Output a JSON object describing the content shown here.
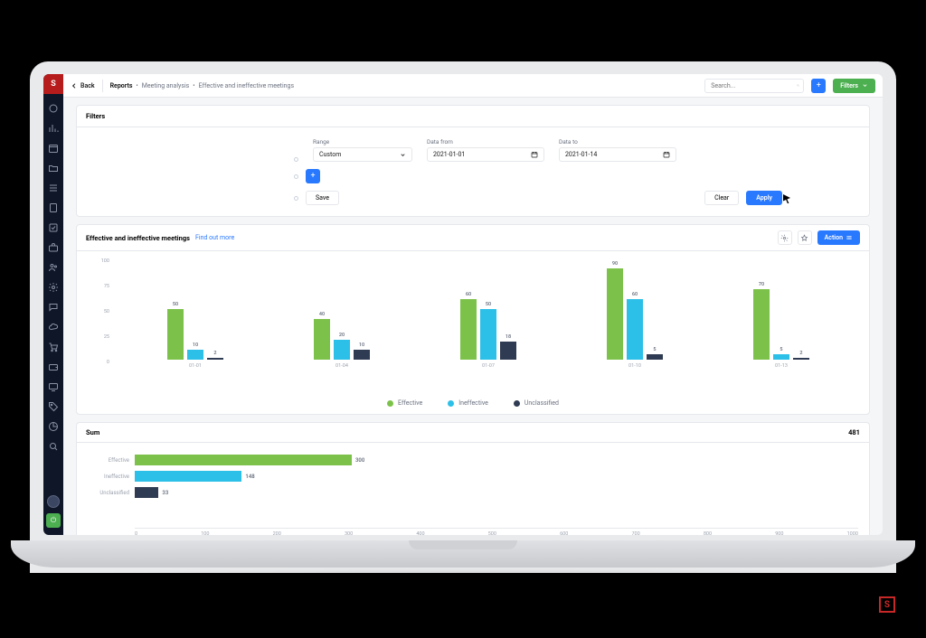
{
  "topbar": {
    "back": "Back",
    "crumb_root": "Reports",
    "crumb_mid": "Meeting analysis",
    "crumb_leaf": "Effective and ineffective meetings",
    "search_placeholder": "Search...",
    "filters_btn": "Filters"
  },
  "filters": {
    "title": "Filters",
    "range_label": "Range",
    "range_value": "Custom",
    "from_label": "Data from",
    "from_value": "2021-01-01",
    "to_label": "Data to",
    "to_value": "2021-01-14",
    "save": "Save",
    "clear": "Clear",
    "apply": "Apply"
  },
  "chart": {
    "title": "Effective and ineffective meetings",
    "link": "Find out more",
    "action": "Action",
    "legend": {
      "a": "Effective",
      "b": "Ineffective",
      "c": "Unclassified"
    },
    "yticks": [
      "100",
      "75",
      "50",
      "25",
      "0"
    ]
  },
  "sum": {
    "title": "Sum",
    "total": "481",
    "xticks": [
      "0",
      "100",
      "200",
      "300",
      "400",
      "500",
      "600",
      "700",
      "800",
      "900",
      "1000"
    ],
    "rows": {
      "effective_label": "Effective",
      "ineffective_label": "Ineffective",
      "unclassified_label": "Unclassified"
    }
  },
  "chart_data": [
    {
      "type": "bar",
      "title": "Effective and ineffective meetings",
      "ylim": [
        0,
        100
      ],
      "categories": [
        "01-01",
        "01-04",
        "01-07",
        "01-10",
        "01-13"
      ],
      "series": [
        {
          "name": "Effective",
          "color": "#7cc24a",
          "values": [
            50,
            40,
            60,
            90,
            70
          ]
        },
        {
          "name": "Ineffective",
          "color": "#2cc0e8",
          "values": [
            10,
            20,
            50,
            60,
            5
          ]
        },
        {
          "name": "Unclassified",
          "color": "#2f3b52",
          "values": [
            2,
            10,
            18,
            5,
            2
          ]
        }
      ]
    },
    {
      "type": "bar",
      "title": "Sum",
      "orientation": "horizontal",
      "xlim": [
        0,
        1000
      ],
      "categories": [
        "Effective",
        "Ineffective",
        "Unclassified"
      ],
      "series": [
        {
          "name": "Effective",
          "color": "#7cc24a",
          "values": [
            300
          ]
        },
        {
          "name": "Ineffective",
          "color": "#2cc0e8",
          "values": [
            148
          ]
        },
        {
          "name": "Unclassified",
          "color": "#2f3b52",
          "values": [
            33
          ]
        }
      ],
      "values": [
        300,
        148,
        33
      ],
      "total": 481
    }
  ]
}
